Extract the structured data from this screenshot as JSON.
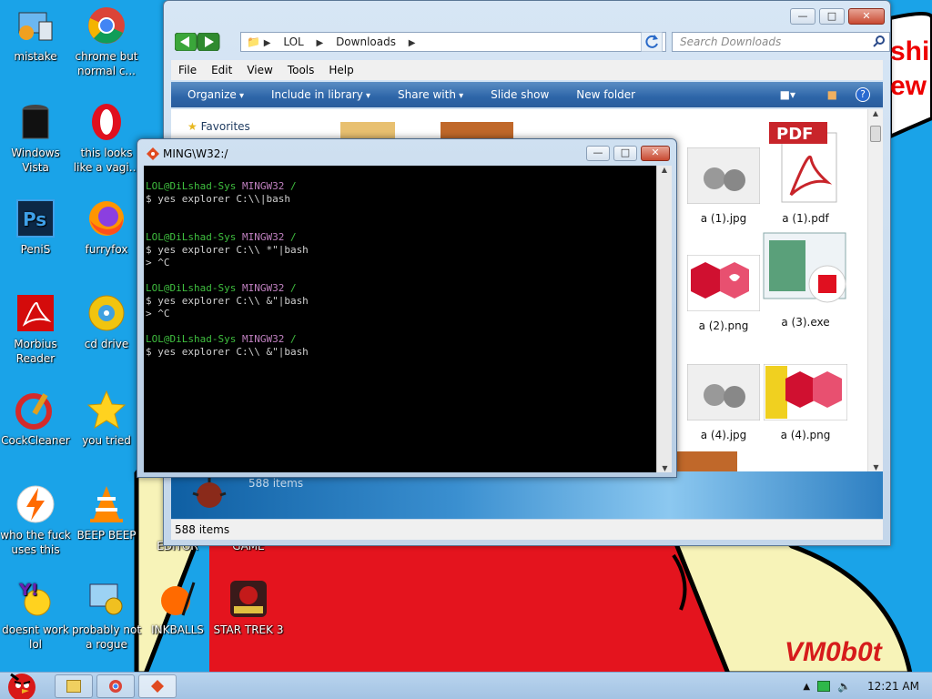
{
  "desktop": {
    "icons": [
      {
        "label": "mistake"
      },
      {
        "label": "chrome but normal c..."
      },
      {
        "label": "Windows Vista"
      },
      {
        "label": "this looks like a vagi..."
      },
      {
        "label": "PeniS"
      },
      {
        "label": "furryfox"
      },
      {
        "label": "Morbius Reader"
      },
      {
        "label": "cd drive"
      },
      {
        "label": "CockCleaner"
      },
      {
        "label": "you tried"
      },
      {
        "label": "who the fuck uses this"
      },
      {
        "label": "BEEP BEEP"
      },
      {
        "label": "EDITOR"
      },
      {
        "label": "GAME"
      },
      {
        "label": "doesnt work lol"
      },
      {
        "label": "probably not a rogue"
      },
      {
        "label": "INKBALLS"
      },
      {
        "label": "STAR TREK 3"
      }
    ],
    "watermark": "VM0b0t",
    "partial_text": "shi\new"
  },
  "explorer": {
    "breadcrumb": [
      "LOL",
      "Downloads"
    ],
    "search_placeholder": "Search Downloads",
    "menu": [
      "File",
      "Edit",
      "View",
      "Tools",
      "Help"
    ],
    "commands": [
      {
        "label": "Organize"
      },
      {
        "label": "Include in library"
      },
      {
        "label": "Share with"
      },
      {
        "label": "Slide show"
      },
      {
        "label": "New folder"
      }
    ],
    "favorites": "Favorites",
    "files": [
      {
        "name": "a (1).jpg"
      },
      {
        "name": "a (1).pdf"
      },
      {
        "name": "a (2).png"
      },
      {
        "name": "a (3).exe"
      },
      {
        "name": "a (4).jpg"
      },
      {
        "name": "a (4).png"
      }
    ],
    "pdf_label": "PDF",
    "ghost_count": "588 items",
    "status": "588 items"
  },
  "terminal": {
    "title": "MING\\W32:/",
    "lines": [
      {
        "user": "LOL@DiLshad-Sys",
        "host": "MINGW32",
        "path": "/"
      },
      "$ yes explorer C:\\\\|bash",
      "",
      "",
      {
        "user": "LOL@DiLshad-Sys",
        "host": "MINGW32",
        "path": "/"
      },
      "$ yes explorer C:\\\\ *\"|bash",
      "> ^C",
      "",
      {
        "user": "LOL@DiLshad-Sys",
        "host": "MINGW32",
        "path": "/"
      },
      "$ yes explorer C:\\\\ &\"|bash",
      "> ^C",
      "",
      {
        "user": "LOL@DiLshad-Sys",
        "host": "MINGW32",
        "path": "/"
      },
      "$ yes explorer C:\\\\ &\"|bash"
    ]
  },
  "taskbar": {
    "clock": "12:21 AM"
  },
  "colors": {
    "desktop_blue": "#1aa3e8",
    "command_bar": "#2d65a8",
    "prompt_green": "#3fbf3f",
    "prompt_magenta": "#c080c0"
  }
}
